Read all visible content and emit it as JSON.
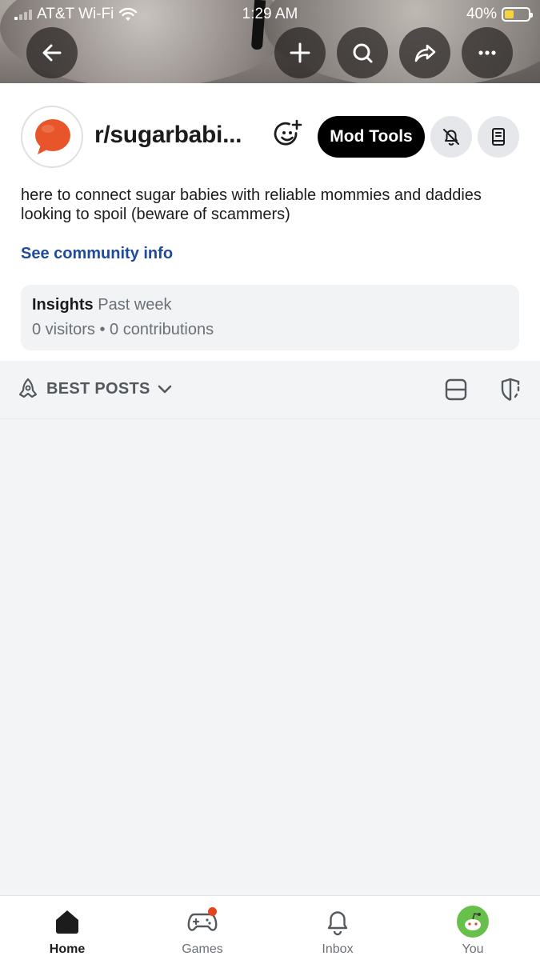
{
  "status_bar": {
    "carrier": "AT&T Wi-Fi",
    "time": "1:29 AM",
    "battery": "40%",
    "battery_level": 0.4
  },
  "header_actions": {
    "back": "back-arrow-icon",
    "create": "plus-icon",
    "search": "search-icon",
    "share": "share-icon",
    "more": "more-icon"
  },
  "community": {
    "name": "r/sugarbabi...",
    "mod_tools_label": "Mod Tools",
    "description": "here to connect sugar babies with reliable mommies and daddies looking to spoil (beware of scammers)",
    "see_info_label": "See community info",
    "accent_color": "#e8552a"
  },
  "insights": {
    "title": "Insights",
    "period": "Past week",
    "visitors": "0 visitors",
    "separator": "•",
    "contributions": "0 contributions"
  },
  "feed": {
    "sort_label": "BEST POSTS"
  },
  "bottom_nav": {
    "items": [
      {
        "label": "Home",
        "icon": "home-icon",
        "active": true
      },
      {
        "label": "Games",
        "icon": "gamepad-icon",
        "active": false
      },
      {
        "label": "Inbox",
        "icon": "bell-icon",
        "active": false
      },
      {
        "label": "You",
        "icon": "avatar",
        "active": false
      }
    ]
  }
}
